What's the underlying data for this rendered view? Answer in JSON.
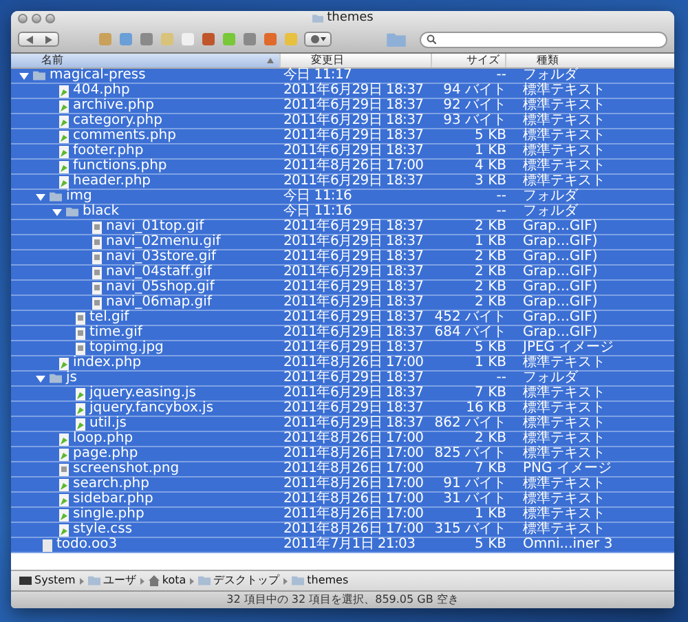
{
  "window": {
    "title": "themes"
  },
  "columns": [
    {
      "label": "名前",
      "sorted": true
    },
    {
      "label": "変更日",
      "sorted": false
    },
    {
      "label": "サイズ",
      "sorted": false
    },
    {
      "label": "種類",
      "sorted": false
    }
  ],
  "rows": [
    {
      "name": "magical-press",
      "date": "今日 11:17",
      "size": "--",
      "type": "フォルダ",
      "kind": "folder",
      "selected": true,
      "expanded": true,
      "children": [
        {
          "name": "404.php",
          "date": "2011年6月29日 18:37",
          "size": "94 バイト",
          "type": "標準テキスト",
          "kind": "text",
          "selected": true
        },
        {
          "name": "archive.php",
          "date": "2011年6月29日 18:37",
          "size": "92 バイト",
          "type": "標準テキスト",
          "kind": "text",
          "selected": true
        },
        {
          "name": "category.php",
          "date": "2011年6月29日 18:37",
          "size": "93 バイト",
          "type": "標準テキスト",
          "kind": "text",
          "selected": true
        },
        {
          "name": "comments.php",
          "date": "2011年6月29日 18:37",
          "size": "5 KB",
          "type": "標準テキスト",
          "kind": "text",
          "selected": true
        },
        {
          "name": "footer.php",
          "date": "2011年6月29日 18:37",
          "size": "1 KB",
          "type": "標準テキスト",
          "kind": "text",
          "selected": true
        },
        {
          "name": "functions.php",
          "date": "2011年8月26日 17:00",
          "size": "4 KB",
          "type": "標準テキスト",
          "kind": "text",
          "selected": true
        },
        {
          "name": "header.php",
          "date": "2011年6月29日 18:37",
          "size": "3 KB",
          "type": "標準テキスト",
          "kind": "text",
          "selected": true
        },
        {
          "name": "img",
          "date": "今日 11:16",
          "size": "--",
          "type": "フォルダ",
          "kind": "folder",
          "selected": true,
          "expanded": true,
          "children": [
            {
              "name": "black",
              "date": "今日 11:16",
              "size": "--",
              "type": "フォルダ",
              "kind": "folder",
              "selected": true,
              "expanded": true,
              "children": [
                {
                  "name": "navi_01top.gif",
                  "date": "2011年6月29日 18:37",
                  "size": "2 KB",
                  "type": "Grap...GIF)",
                  "kind": "image",
                  "selected": true
                },
                {
                  "name": "navi_02menu.gif",
                  "date": "2011年6月29日 18:37",
                  "size": "1 KB",
                  "type": "Grap...GIF)",
                  "kind": "image",
                  "selected": true
                },
                {
                  "name": "navi_03store.gif",
                  "date": "2011年6月29日 18:37",
                  "size": "2 KB",
                  "type": "Grap...GIF)",
                  "kind": "image",
                  "selected": true
                },
                {
                  "name": "navi_04staff.gif",
                  "date": "2011年6月29日 18:37",
                  "size": "2 KB",
                  "type": "Grap...GIF)",
                  "kind": "image",
                  "selected": true
                },
                {
                  "name": "navi_05shop.gif",
                  "date": "2011年6月29日 18:37",
                  "size": "2 KB",
                  "type": "Grap...GIF)",
                  "kind": "image",
                  "selected": true
                },
                {
                  "name": "navi_06map.gif",
                  "date": "2011年6月29日 18:37",
                  "size": "2 KB",
                  "type": "Grap...GIF)",
                  "kind": "image",
                  "selected": true
                }
              ]
            },
            {
              "name": "tel.gif",
              "date": "2011年6月29日 18:37",
              "size": "452 バイト",
              "type": "Grap...GIF)",
              "kind": "image",
              "selected": true
            },
            {
              "name": "time.gif",
              "date": "2011年6月29日 18:37",
              "size": "684 バイト",
              "type": "Grap...GIF)",
              "kind": "image",
              "selected": true
            },
            {
              "name": "topimg.jpg",
              "date": "2011年6月29日 18:37",
              "size": "5 KB",
              "type": "JPEG イメージ",
              "kind": "image",
              "selected": true
            }
          ]
        },
        {
          "name": "index.php",
          "date": "2011年8月26日 17:00",
          "size": "1 KB",
          "type": "標準テキスト",
          "kind": "text",
          "selected": true
        },
        {
          "name": "js",
          "date": "2011年6月29日 18:37",
          "size": "--",
          "type": "フォルダ",
          "kind": "folder",
          "selected": true,
          "expanded": true,
          "children": [
            {
              "name": "jquery.easing.js",
              "date": "2011年6月29日 18:37",
              "size": "7 KB",
              "type": "標準テキスト",
              "kind": "text",
              "selected": true
            },
            {
              "name": "jquery.fancybox.js",
              "date": "2011年6月29日 18:37",
              "size": "16 KB",
              "type": "標準テキスト",
              "kind": "text",
              "selected": true
            },
            {
              "name": "util.js",
              "date": "2011年6月29日 18:37",
              "size": "862 バイト",
              "type": "標準テキスト",
              "kind": "text",
              "selected": true
            }
          ]
        },
        {
          "name": "loop.php",
          "date": "2011年8月26日 17:00",
          "size": "2 KB",
          "type": "標準テキスト",
          "kind": "text",
          "selected": true
        },
        {
          "name": "page.php",
          "date": "2011年8月26日 17:00",
          "size": "825 バイト",
          "type": "標準テキスト",
          "kind": "text",
          "selected": true
        },
        {
          "name": "screenshot.png",
          "date": "2011年8月26日 17:00",
          "size": "7 KB",
          "type": "PNG イメージ",
          "kind": "image",
          "selected": true
        },
        {
          "name": "search.php",
          "date": "2011年8月26日 17:00",
          "size": "91 バイト",
          "type": "標準テキスト",
          "kind": "text",
          "selected": true
        },
        {
          "name": "sidebar.php",
          "date": "2011年8月26日 17:00",
          "size": "31 バイト",
          "type": "標準テキスト",
          "kind": "text",
          "selected": true
        },
        {
          "name": "single.php",
          "date": "2011年8月26日 17:00",
          "size": "1 KB",
          "type": "標準テキスト",
          "kind": "text",
          "selected": true
        },
        {
          "name": "style.css",
          "date": "2011年8月26日 17:00",
          "size": "315 バイト",
          "type": "標準テキスト",
          "kind": "text",
          "selected": true
        }
      ]
    },
    {
      "name": "todo.oo3",
      "date": "2011年7月1日 21:03",
      "size": "5 KB",
      "type": "Omni...iner 3",
      "kind": "document",
      "selected": true
    }
  ],
  "path_bar": [
    {
      "label": "System",
      "kind": "disk"
    },
    {
      "label": "ユーザ",
      "kind": "folder"
    },
    {
      "label": "kota",
      "kind": "home"
    },
    {
      "label": "デスクトップ",
      "kind": "folder"
    },
    {
      "label": "themes",
      "kind": "folder"
    }
  ],
  "status_bar": "32 項目中の 32 項目を選択、859.05 GB 空き"
}
